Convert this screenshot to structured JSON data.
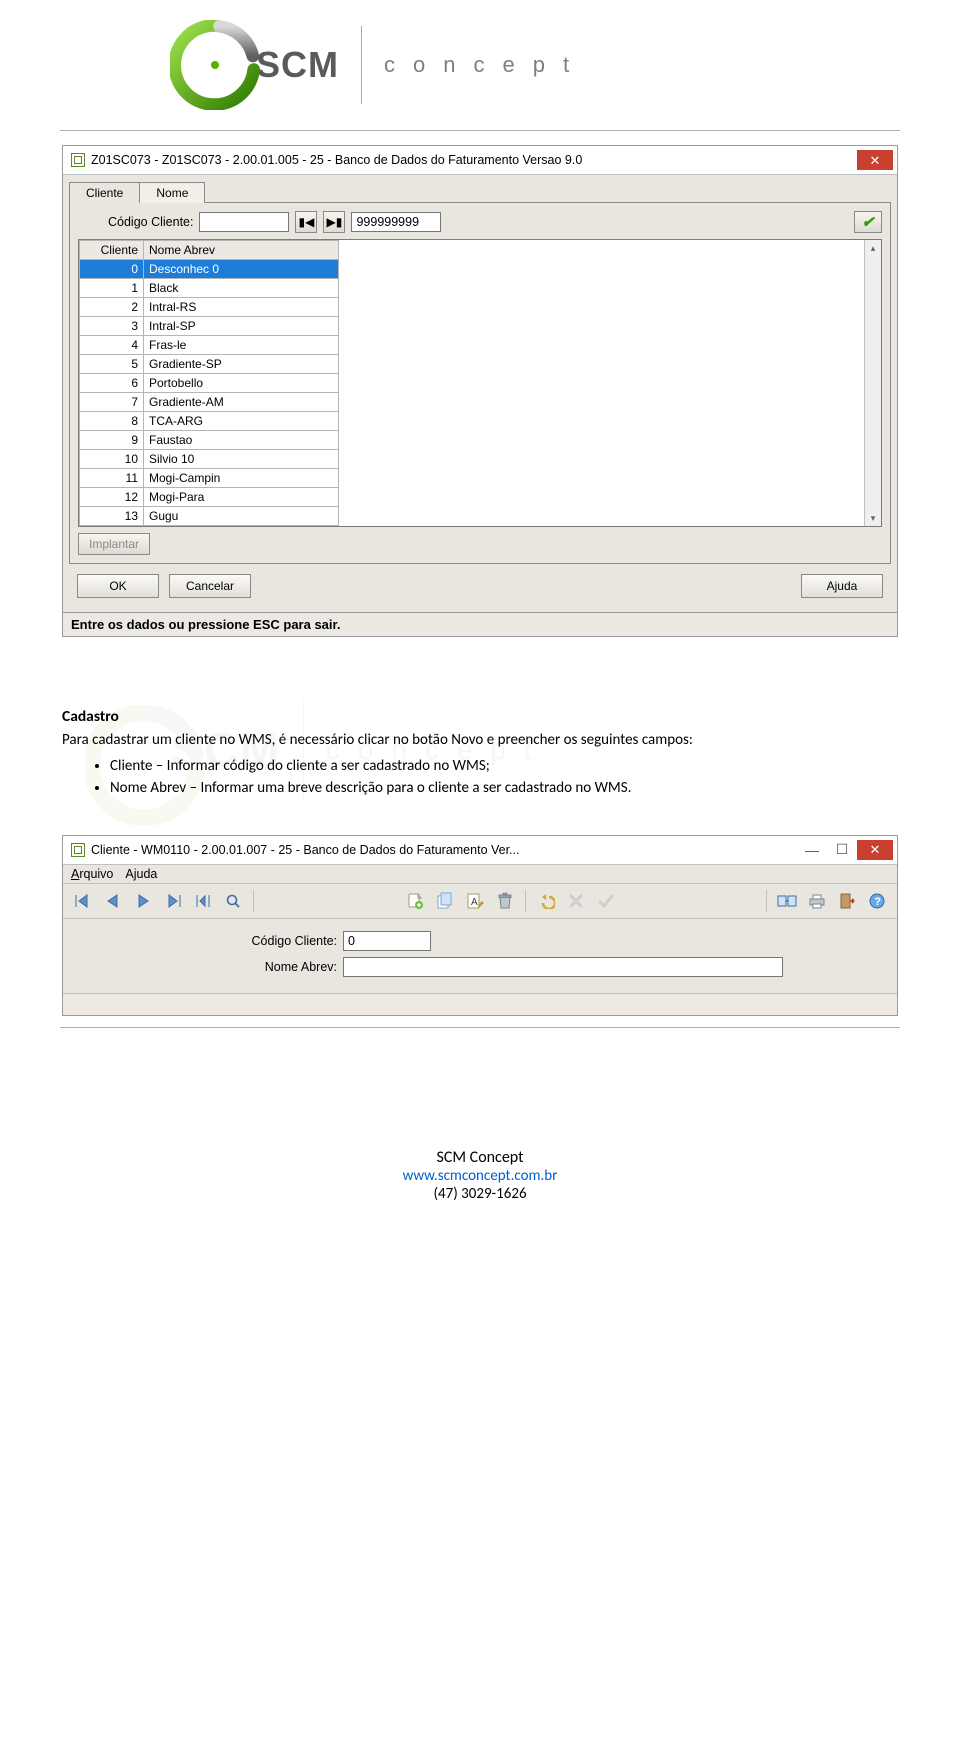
{
  "header": {
    "brand": "SCM",
    "tagline": "concept"
  },
  "window1": {
    "title": "Z01SC073 - Z01SC073 - 2.00.01.005 - 25 - Banco de Dados do Faturamento Versao 9.0",
    "tabs": [
      "Cliente",
      "Nome"
    ],
    "active_tab": 0,
    "codigo_label": "Código Cliente:",
    "codigo_value": "",
    "goto_value": "999999999",
    "grid": {
      "columns": [
        "Cliente",
        "Nome Abrev"
      ],
      "rows": [
        {
          "id": "0",
          "nome": "Desconhec 0",
          "selected": true
        },
        {
          "id": "1",
          "nome": "Black"
        },
        {
          "id": "2",
          "nome": "Intral-RS"
        },
        {
          "id": "3",
          "nome": "Intral-SP"
        },
        {
          "id": "4",
          "nome": "Fras-le"
        },
        {
          "id": "5",
          "nome": "Gradiente-SP"
        },
        {
          "id": "6",
          "nome": "Portobello"
        },
        {
          "id": "7",
          "nome": "Gradiente-AM"
        },
        {
          "id": "8",
          "nome": "TCA-ARG"
        },
        {
          "id": "9",
          "nome": "Faustao"
        },
        {
          "id": "10",
          "nome": "Silvio 10"
        },
        {
          "id": "11",
          "nome": "Mogi-Campin"
        },
        {
          "id": "12",
          "nome": "Mogi-Para"
        },
        {
          "id": "13",
          "nome": "Gugu"
        }
      ]
    },
    "implantar": "Implantar",
    "buttons": {
      "ok": "OK",
      "cancel": "Cancelar",
      "help": "Ajuda"
    },
    "status": "Entre os dados ou pressione ESC para sair."
  },
  "document": {
    "heading": "Cadastro",
    "para": "Para cadastrar um cliente no WMS, é necessário clicar no botão Novo e preencher os seguintes campos:",
    "bullets": [
      "Cliente – Informar código do cliente a ser cadastrado no WMS;",
      "Nome Abrev – Informar uma breve descrição para o cliente a ser cadastrado no WMS."
    ]
  },
  "window2": {
    "title": "Cliente - WM0110 - 2.00.01.007 - 25 - Banco de Dados do Faturamento Ver...",
    "menu": {
      "arquivo": "Arquivo",
      "ajuda": "Ajuda"
    },
    "fields": {
      "codigo_label": "Código Cliente:",
      "codigo_value": "0",
      "nome_label": "Nome Abrev:",
      "nome_value": ""
    }
  },
  "footer": {
    "name": "SCM Concept",
    "url": "www.scmconcept.com.br",
    "phone": "(47) 3029-1626"
  }
}
